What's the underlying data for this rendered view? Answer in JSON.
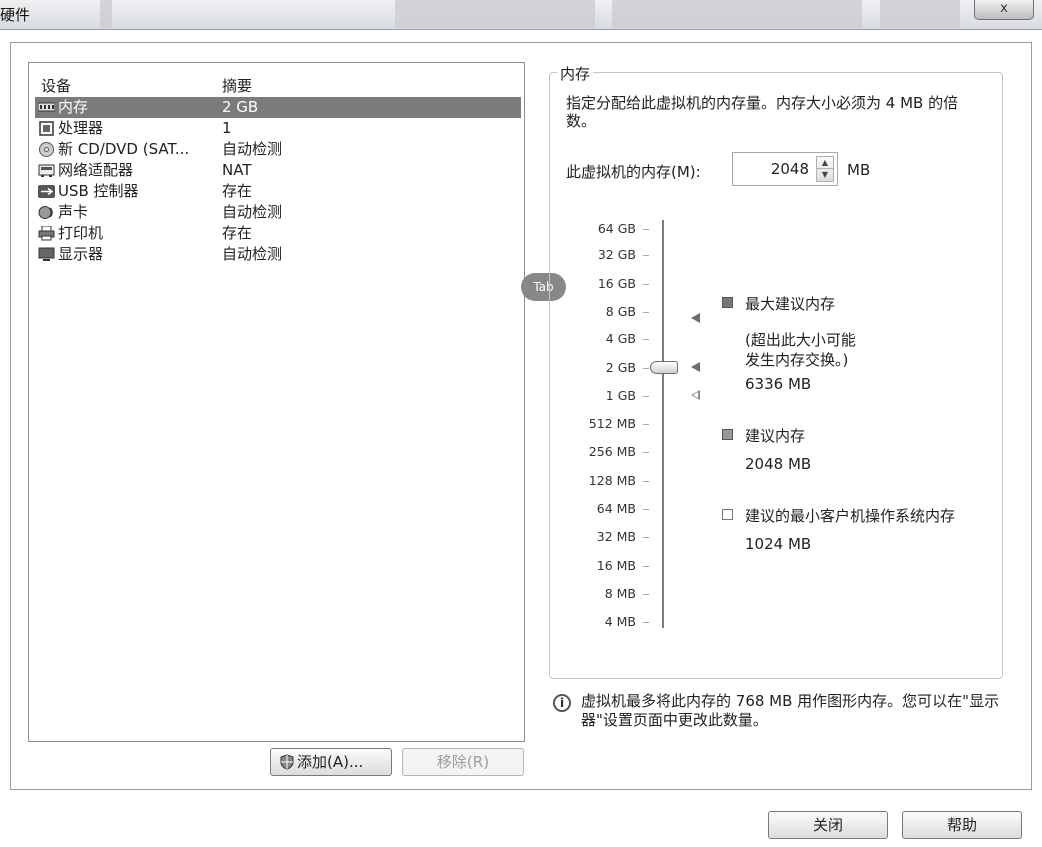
{
  "window": {
    "title": "硬件",
    "close_glyph": "x"
  },
  "device_list": {
    "headers": {
      "device": "设备",
      "summary": "摘要"
    },
    "rows": [
      {
        "name": "内存",
        "summary": "2 GB",
        "icon": "memory-icon"
      },
      {
        "name": "处理器",
        "summary": "1",
        "icon": "processor-icon"
      },
      {
        "name": "新 CD/DVD (SAT...",
        "summary": "自动检测",
        "icon": "cd-dvd-icon"
      },
      {
        "name": "网络适配器",
        "summary": "NAT",
        "icon": "network-adapter-icon"
      },
      {
        "name": "USB 控制器",
        "summary": "存在",
        "icon": "usb-icon"
      },
      {
        "name": "声卡",
        "summary": "自动检测",
        "icon": "sound-card-icon"
      },
      {
        "name": "打印机",
        "summary": "存在",
        "icon": "printer-icon"
      },
      {
        "name": "显示器",
        "summary": "自动检测",
        "icon": "display-icon"
      }
    ]
  },
  "buttons": {
    "add": "添加(A)...",
    "remove": "移除(R)",
    "close": "关闭",
    "help": "帮助"
  },
  "memory": {
    "group_title": "内存",
    "description": "指定分配给此虚拟机的内存量。内存大小必须为 4 MB 的倍数。",
    "field_label": "此虚拟机的内存(M):",
    "value": "2048",
    "unit": "MB",
    "scale": [
      "64 GB",
      "32 GB",
      "16 GB",
      "8 GB",
      "4 GB",
      "2 GB",
      "1 GB",
      "512 MB",
      "256 MB",
      "128 MB",
      "64 MB",
      "32 MB",
      "16 MB",
      "8 MB",
      "4 MB"
    ],
    "legend": {
      "max_title": "最大建议内存",
      "max_note_1": "(超出此大小可能",
      "max_note_2": "发生内存交换。)",
      "max_value": "6336 MB",
      "recommended_title": "建议内存",
      "recommended_value": "2048 MB",
      "min_title": "建议的最小客户机操作系统内存",
      "min_value": "1024 MB"
    },
    "info": "虚拟机最多将此内存的 768 MB 用作图形内存。您可以在\"显示器\"设置页面中更改此数量。"
  },
  "tab_badge": "Tab"
}
